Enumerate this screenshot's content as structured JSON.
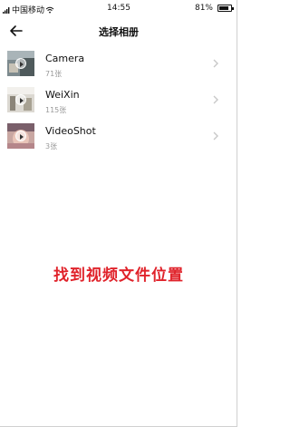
{
  "status_bar": {
    "carrier": "中国移动",
    "time": "14:55",
    "battery_percent": "81%",
    "battery_level": 0.81,
    "signal_icon": "signal-bars-icon",
    "wifi_icon": "wifi-icon",
    "battery_icon": "battery-icon"
  },
  "header": {
    "back_icon": "back-arrow-icon",
    "title": "选择相册"
  },
  "albums": [
    {
      "name": "Camera",
      "count": "71张"
    },
    {
      "name": "WeiXin",
      "count": "115张"
    },
    {
      "name": "VideoShot",
      "count": "3张"
    }
  ],
  "annotation": {
    "text": "找到视频文件位置",
    "color": "#e0232b"
  },
  "colors": {
    "background": "#ffffff",
    "text_primary": "#111111",
    "text_secondary": "#999999",
    "chevron": "#c8c8c8"
  }
}
